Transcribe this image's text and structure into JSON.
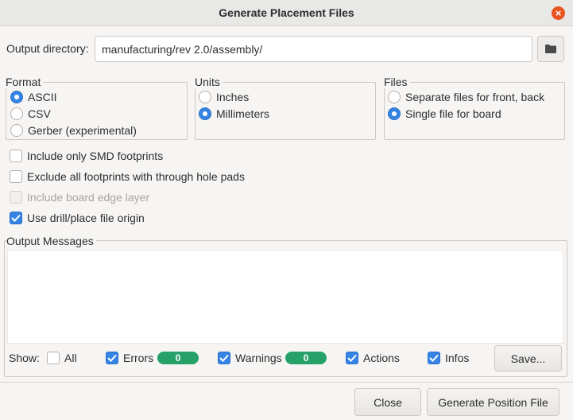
{
  "window": {
    "title": "Generate Placement Files"
  },
  "output_directory": {
    "label": "Output directory:",
    "value": "manufacturing/rev 2.0/assembly/"
  },
  "format": {
    "title": "Format",
    "options": [
      {
        "label": "ASCII",
        "selected": true
      },
      {
        "label": "CSV",
        "selected": false
      },
      {
        "label": "Gerber (experimental)",
        "selected": false
      }
    ]
  },
  "units": {
    "title": "Units",
    "options": [
      {
        "label": "Inches",
        "selected": false
      },
      {
        "label": "Millimeters",
        "selected": true
      }
    ]
  },
  "files": {
    "title": "Files",
    "options": [
      {
        "label": "Separate files for front, back",
        "selected": false
      },
      {
        "label": "Single file for board",
        "selected": true
      }
    ]
  },
  "checkboxes": [
    {
      "label": "Include only SMD footprints",
      "checked": false,
      "enabled": true
    },
    {
      "label": "Exclude all footprints with through hole pads",
      "checked": false,
      "enabled": true
    },
    {
      "label": "Include board edge layer",
      "checked": false,
      "enabled": false
    },
    {
      "label": "Use drill/place file origin",
      "checked": true,
      "enabled": true
    }
  ],
  "messages": {
    "title": "Output Messages",
    "show_label": "Show:",
    "filters": {
      "all": {
        "label": "All",
        "checked": false
      },
      "errors": {
        "label": "Errors",
        "checked": true,
        "count": "0"
      },
      "warnings": {
        "label": "Warnings",
        "checked": true,
        "count": "0"
      },
      "actions": {
        "label": "Actions",
        "checked": true
      },
      "infos": {
        "label": "Infos",
        "checked": true
      }
    },
    "save_label": "Save..."
  },
  "footer": {
    "close_label": "Close",
    "generate_label": "Generate Position File"
  },
  "colors": {
    "accent": "#3584e4",
    "badge": "#26a269",
    "close": "#e95420"
  }
}
